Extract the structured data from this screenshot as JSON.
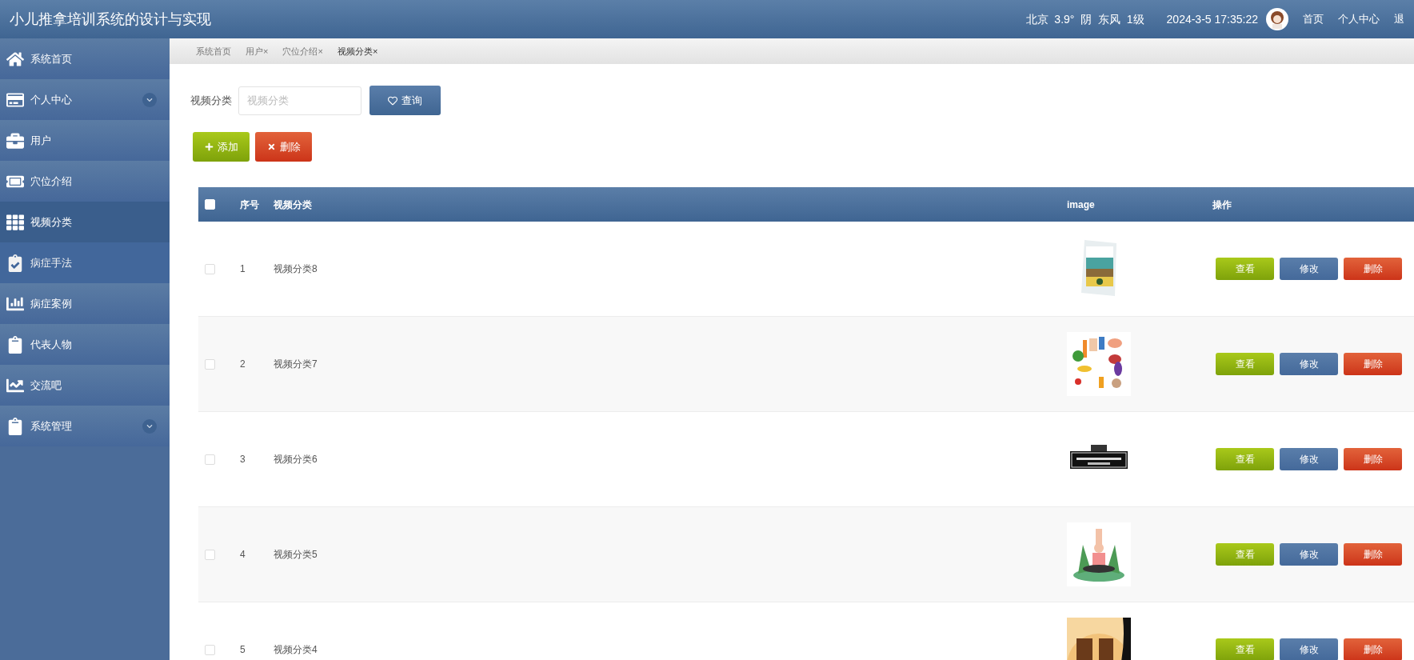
{
  "header": {
    "title": "小儿推拿培训系统的设计与实现",
    "weather": "北京  3.9°  阴  东风  1级",
    "datetime": "2024-3-5 17:35:22",
    "links": [
      "首页",
      "个人中心",
      "退"
    ]
  },
  "sidebar": {
    "items": [
      {
        "label": "系统首页",
        "kind": "link",
        "selected": false,
        "hovered": false
      },
      {
        "label": "个人中心",
        "kind": "group",
        "selected": false,
        "hovered": false
      },
      {
        "label": "用户",
        "kind": "link",
        "selected": false,
        "hovered": false
      },
      {
        "label": "穴位介绍",
        "kind": "link",
        "selected": false,
        "hovered": false
      },
      {
        "label": "视频分类",
        "kind": "link",
        "selected": true,
        "hovered": false
      },
      {
        "label": "病症手法",
        "kind": "link",
        "selected": false,
        "hovered": true
      },
      {
        "label": "病症案例",
        "kind": "link",
        "selected": false,
        "hovered": false
      },
      {
        "label": "代表人物",
        "kind": "link",
        "selected": false,
        "hovered": false
      },
      {
        "label": "交流吧",
        "kind": "link",
        "selected": false,
        "hovered": false
      },
      {
        "label": "系统管理",
        "kind": "group",
        "selected": false,
        "hovered": false
      }
    ]
  },
  "tabs": [
    {
      "label": "系统首页",
      "selected": false
    },
    {
      "label": "用户",
      "close": "×",
      "selected": false
    },
    {
      "label": "穴位介绍",
      "close": "×",
      "selected": false
    },
    {
      "label": "视频分类",
      "close": "×",
      "selected": true
    }
  ],
  "search": {
    "label": "视频分类",
    "placeholder": "视频分类",
    "button": "查询"
  },
  "actions": {
    "add": "添加",
    "delete": "删除"
  },
  "table": {
    "select_all": {
      "checked": false
    },
    "columns": [
      "序号",
      "视频分类",
      "image",
      "操作"
    ],
    "rows": [
      {
        "index": "1",
        "name": "视频分类8",
        "checked": false,
        "image": {
          "kind": "picture"
        },
        "buttons": [
          "查看",
          "修改",
          "删除"
        ]
      },
      {
        "index": "2",
        "name": "视频分类7",
        "checked": false,
        "image": {
          "kind": "picture"
        },
        "buttons": [
          "查看",
          "修改",
          "删除"
        ]
      },
      {
        "index": "3",
        "name": "视频分类6",
        "checked": false,
        "image": {
          "kind": "picture"
        },
        "buttons": [
          "查看",
          "修改",
          "删除"
        ]
      },
      {
        "index": "4",
        "name": "视频分类5",
        "checked": false,
        "image": {
          "kind": "picture"
        },
        "buttons": [
          "查看",
          "修改",
          "删除"
        ]
      },
      {
        "index": "5",
        "name": "视频分类4",
        "checked": false,
        "image": {
          "kind": "picture"
        },
        "buttons": [
          "查看",
          "修改",
          "删除"
        ]
      }
    ]
  }
}
